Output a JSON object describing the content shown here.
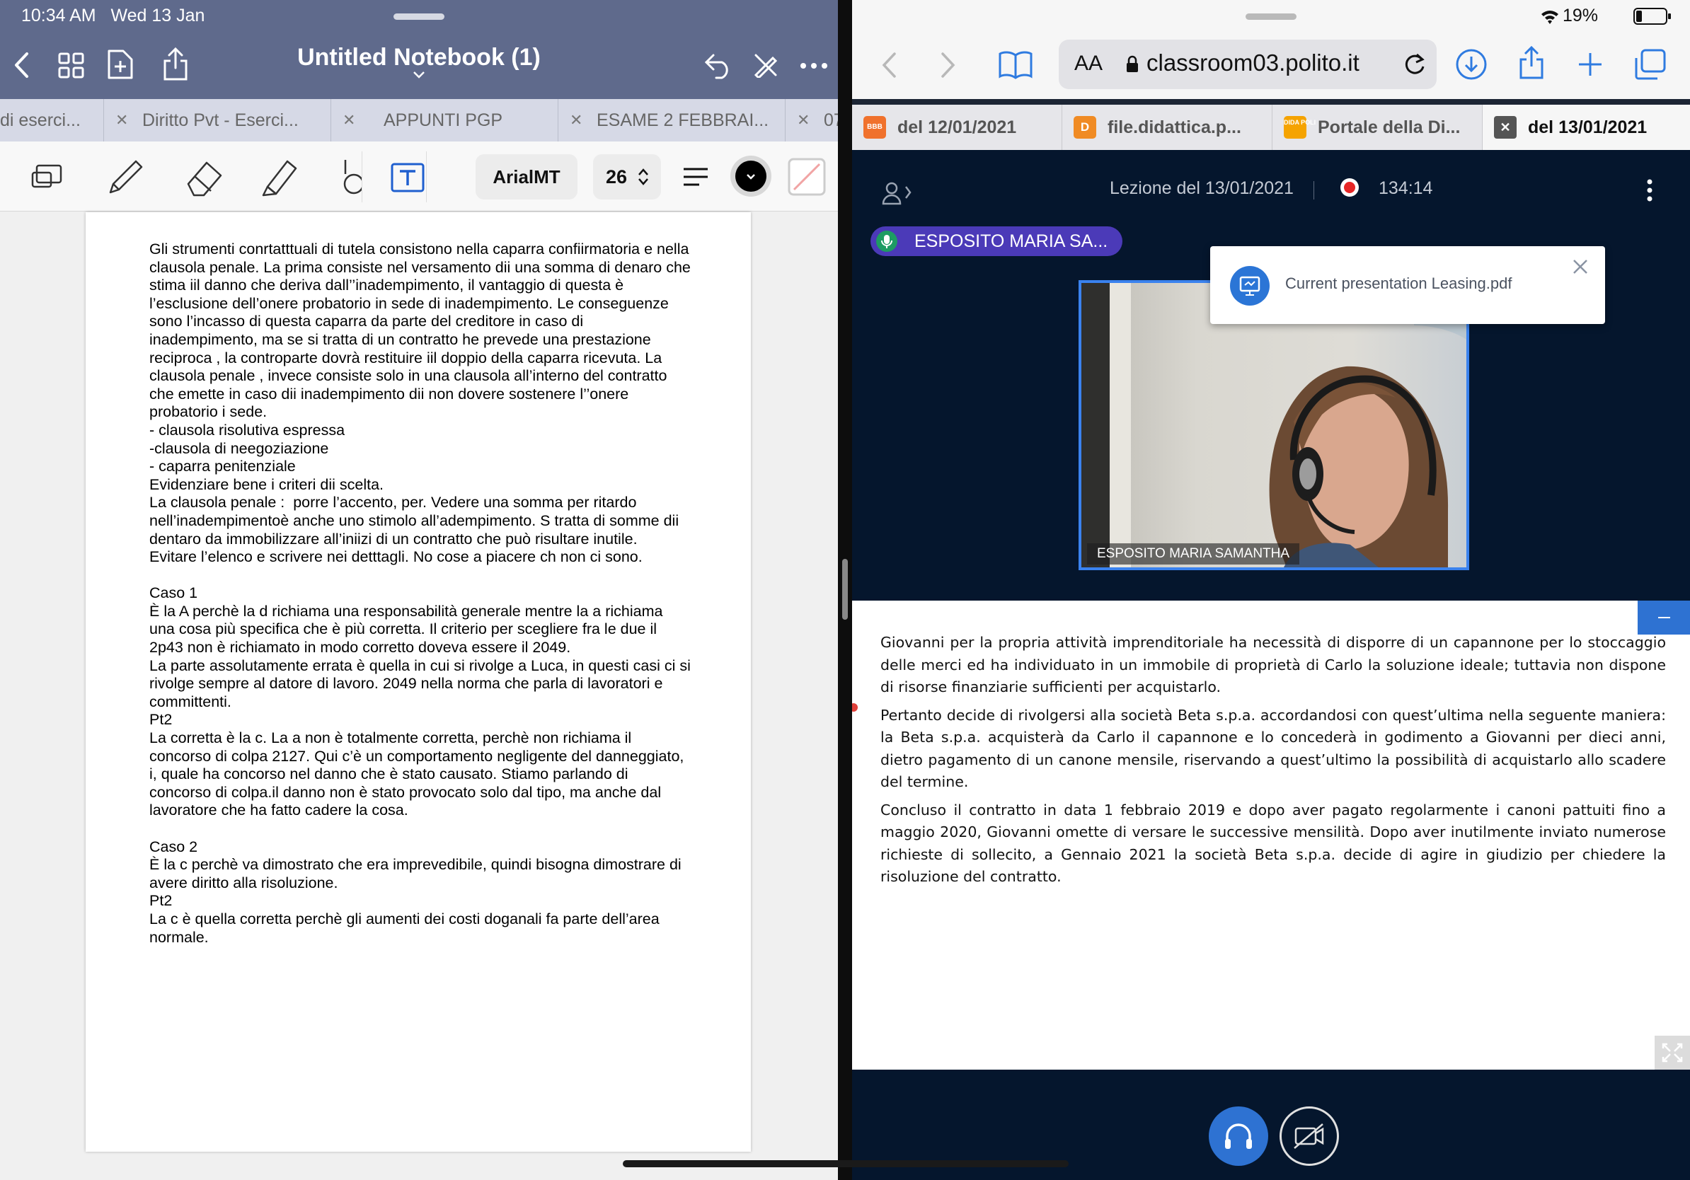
{
  "status": {
    "time": "10:34 AM",
    "date": "Wed 13 Jan",
    "battery": "19%"
  },
  "notes": {
    "title": "Untitled Notebook (1)",
    "tabs": [
      {
        "label": "di eserci..."
      },
      {
        "label": "Diritto Pvt - Eserci..."
      },
      {
        "label": "APPUNTI PGP"
      },
      {
        "label": "ESAME 2 FEBBRAI..."
      },
      {
        "label": "07"
      }
    ],
    "font_name": "ArialMT",
    "font_size": "26",
    "color_black": "#000000",
    "page_lines": [
      "Gli strumenti conrtatttuali di tutela consistono nella caparra confiirmatoria e nella",
      "clausola penale. La prima consiste nel versamento dii una somma di denaro che",
      "stima iil danno che deriva dall’’inadempimento, il vantaggio di questa è",
      "l’esclusione dell’onere probatorio in sede di inadempimento. Le conseguenze",
      "sono l’incasso di questa caparra da parte del creditore in caso di",
      "inadempimento, ma se si tratta di un contratto he prevede una prestazione",
      "reciproca , la controparte dovrà restituire iil doppio della caparra ricevuta. La",
      "clausola penale , invece consiste solo in una clausola all’interno del contratto",
      "che emette in caso dii inadempimento dii non dovere sostenere l’’onere",
      "probatorio i sede.",
      "- clausola risolutiva espressa",
      "-clausola di neegoziazione",
      "- caparra penitenziale",
      "Evidenziare bene i criteri dii scelta.",
      "La clausola penale :  porre l’accento, per. Vedere una somma per ritardo",
      "nell’inadempimentoè anche uno stimolo all’adempimento. S tratta di somme dii",
      "dentaro da immobilizzare all’iniizi di un contratto che può risultare inutile.",
      "Evitare l’elenco e scrivere nei detttagli. No cose a piacere ch non ci sono.",
      "",
      "Caso 1",
      "È la A perchè la d richiama una responsabilità generale mentre la a richiama",
      "una cosa più specifica che è più corretta. Il criterio per scegliere fra le due il",
      "2p43 non è richiamato in modo corretto doveva essere il 2049.",
      "La parte assolutamente errata è quella in cui si rivolge a Luca, in questi casi ci si",
      "rivolge sempre al datore di lavoro. 2049 nella norma che parla di lavoratori e",
      "committenti.",
      "Pt2",
      "La corretta è la c. La a non è totalmente corretta, perchè non richiama il",
      "concorso di colpa 2127. Qui c’è un comportamento negligente del danneggiato,",
      "i, quale ha concorso nel danno che è stato causato. Stiamo parlando di",
      "concorso di colpa.il danno non è stato provocato solo dal tipo, ma anche dal",
      "lavoratore che ha fatto cadere la cosa.",
      "",
      "Caso 2",
      "È la c perchè va dimostrato che era imprevedibile, quindi bisogna dimostrare di",
      "avere diritto alla risoluzione.",
      "Pt2",
      "La c è quella corretta perchè gli aumenti dei costi doganali fa parte dell’area",
      "normale."
    ]
  },
  "safari": {
    "aa": "AA",
    "url": "classroom03.polito.it",
    "tabs": [
      {
        "label": "del 12/01/2021",
        "favicon": "BBB",
        "color": "#f0712c"
      },
      {
        "label": "file.didattica.p...",
        "favicon": "D",
        "color": "#f08b24"
      },
      {
        "label": "Portale della Di...",
        "favicon": "DIDA POLI",
        "color": "#f5a300"
      },
      {
        "label": "del 13/01/2021",
        "favicon": "x",
        "color": "#555555"
      }
    ]
  },
  "meeting": {
    "lesson_title": "Lezione del 13/01/2021",
    "recording_time": "134:14",
    "talker": "ESPOSITO MARIA SA...",
    "presentation_popup": "Current presentation Leasing.pdf",
    "video_caption": "ESPOSITO MARIA SAMANTHA",
    "slide_paragraphs": [
      "Giovanni per la propria attività imprenditoriale ha necessità di disporre di un capannone per lo stoccaggio delle merci ed ha individuato in un immobile di proprietà di Carlo la soluzione ideale; tuttavia non dispone di risorse finanziarie sufficienti per acquistarlo.",
      "Pertanto decide di rivolgersi alla società Beta s.p.a. accordandosi con quest’ultima nella seguente maniera: la Beta s.p.a. acquisterà da Carlo il capannone e lo concederà in godimento a Giovanni per dieci anni, dietro pagamento di un canone mensile, riservando a quest’ultimo la possibilità di acquistarlo allo scadere del termine.",
      "Concluso il contratto in data 1 febbraio 2019 e dopo aver pagato regolarmente i canoni pattuiti fino a maggio 2020, Giovanni omette di versare le successive mensilità. Dopo aver inutilmente inviato numerose richieste di sollecito, a Gennaio 2021 la società Beta s.p.a. decide di agire in giudizio per chiedere la risoluzione del contratto."
    ]
  }
}
